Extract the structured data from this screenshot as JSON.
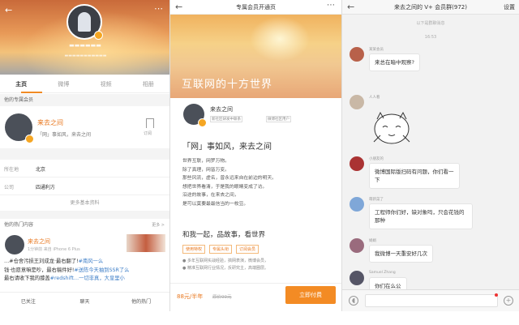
{
  "colors": {
    "accent": "#f38b24",
    "link": "#3d7ec7",
    "name_orange": "#e8761c"
  },
  "profile": {
    "tabs": [
      {
        "label": "主页"
      },
      {
        "label": "微博"
      },
      {
        "label": "视频"
      },
      {
        "label": "相册"
      }
    ],
    "member_section": "他的专属会员",
    "member": {
      "name": "来去之间",
      "desc": "「网」事如风，来去之间",
      "bookmark": "订阅"
    },
    "info": [
      {
        "key": "所在地",
        "value": "北京"
      },
      {
        "key": "公司",
        "value": "四通利方"
      }
    ],
    "more_info": "更多基本资料",
    "hot_section": "他的热门内容",
    "hot_more": "更多 >",
    "hot": {
      "name": "来去之间",
      "meta": "1分钟前 来自 iPhone 6 Plus",
      "line1a": "…#仓舍污损王刘成龙·最右翻了!",
      "line1b": "#南风一么",
      "line2a": "钱·也愿意嘛是吵，最右稿件好!",
      "line2b": "#送陈今天抽到SSR了么",
      "line3a": "最右请收下我的膝盖",
      "line3b": "#redshift…一切非真，大皇里小"
    },
    "bottom": [
      {
        "label": "已关注"
      },
      {
        "label": "聊天"
      },
      {
        "label": "他的热门"
      }
    ]
  },
  "member_page": {
    "title": "专属会员开通页",
    "banner": "互联网的十方世界",
    "author": {
      "name": "来去之间",
      "tag1": "新社区研发中联系",
      "tag2": "微博社区用户"
    },
    "headline": "「网」事如风，来去之间",
    "para": [
      "世界互联，网罗万物。",
      "除了真理，网皆万变。",
      "那些风流，虚名，曾永远来自在前边的明天。",
      "想把世界看清，于是我的眼睛变成了访。",
      "沿途的故事，在来去之间，",
      "是可以莫要最最信当的一枚豆。"
    ],
    "subhead": "和我一起，品故事，看世界",
    "pills": [
      "使用特权",
      "专属头衔",
      "订阅会员"
    ],
    "bullets": [
      "● 多年互联网实战经验，搞网表演，微博会员，",
      "● 精准互联网行业情况，反研究主，高端圈层。"
    ],
    "price": "88元/半年",
    "orig_price": "原价99元",
    "pay": "立即付费"
  },
  "chat": {
    "title": "来去之间的 V+ 会员群(972)",
    "settings": "设置",
    "system": "以下是群聊消息",
    "time": "16:53",
    "messages": [
      {
        "name": "某某会员",
        "text": "来总在暗中观察?"
      },
      {
        "name": "人人看",
        "text": ""
      },
      {
        "name": "小朋友的",
        "text": "微博国际版扫码有问题，你们看一下"
      },
      {
        "name": "萌新菜了",
        "text": "工程师你们好，缺对象吗，只会花钱的那种"
      },
      {
        "name": "娟娟",
        "text": "我微博一天重安好几次"
      },
      {
        "name": "Samuel Zhang",
        "text": "你们在么公"
      }
    ]
  }
}
